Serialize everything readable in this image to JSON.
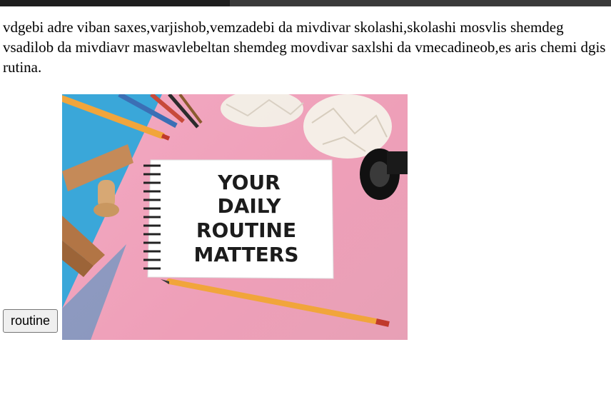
{
  "page": {
    "paragraph": "vdgebi adre viban saxes,varjishob,vemzadebi da mivdivar skolashi,skolashi mosvlis shemdeg vsadilob da mivdiavr maswavlebeltan shemdeg movdivar saxlshi da vmecadineob,es aris chemi dgis rutina.",
    "button_label": "routine"
  },
  "image": {
    "notebook_lines": [
      "YOUR",
      "DAILY",
      "ROUTINE",
      "MATTERS"
    ],
    "colors": {
      "background_pink": "#f0a6bf",
      "blue_paper": "#3aa7d9",
      "pencil": "#f1a53b"
    }
  }
}
